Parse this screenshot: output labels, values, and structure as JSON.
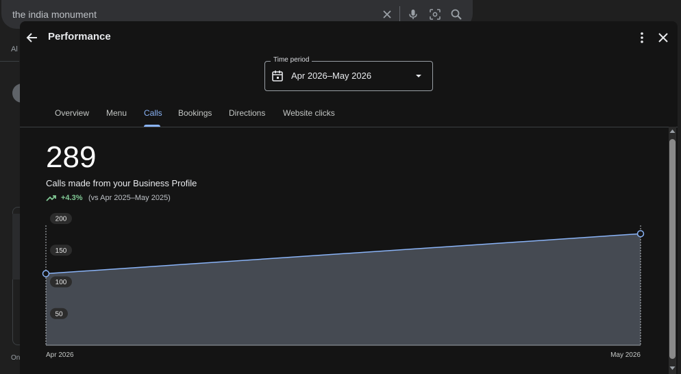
{
  "search": {
    "query": "the india monument"
  },
  "background": {
    "tab_fragment": "Al",
    "bottom_fragment": "On"
  },
  "dialog": {
    "title": "Performance",
    "time_period": {
      "label": "Time period",
      "value": "Apr 2026–May 2026"
    },
    "tabs": [
      "Overview",
      "Menu",
      "Calls",
      "Bookings",
      "Directions",
      "Website clicks"
    ],
    "active_tab": "Calls",
    "metric": {
      "value": "289",
      "description": "Calls made from your Business Profile",
      "change": "+4.3%",
      "comparison": "(vs Apr 2025–May 2025)"
    }
  },
  "colors": {
    "accent": "#8ab4f8",
    "positive": "#81c995",
    "area_fill": "#454a52"
  },
  "chart_data": {
    "type": "area",
    "x": [
      "Apr 2026",
      "May 2026"
    ],
    "series": [
      {
        "values": [
          113,
          176
        ]
      }
    ],
    "y_ticks": [
      "200",
      "150",
      "100",
      "50"
    ],
    "ylim": [
      0,
      200
    ],
    "grid": false
  }
}
